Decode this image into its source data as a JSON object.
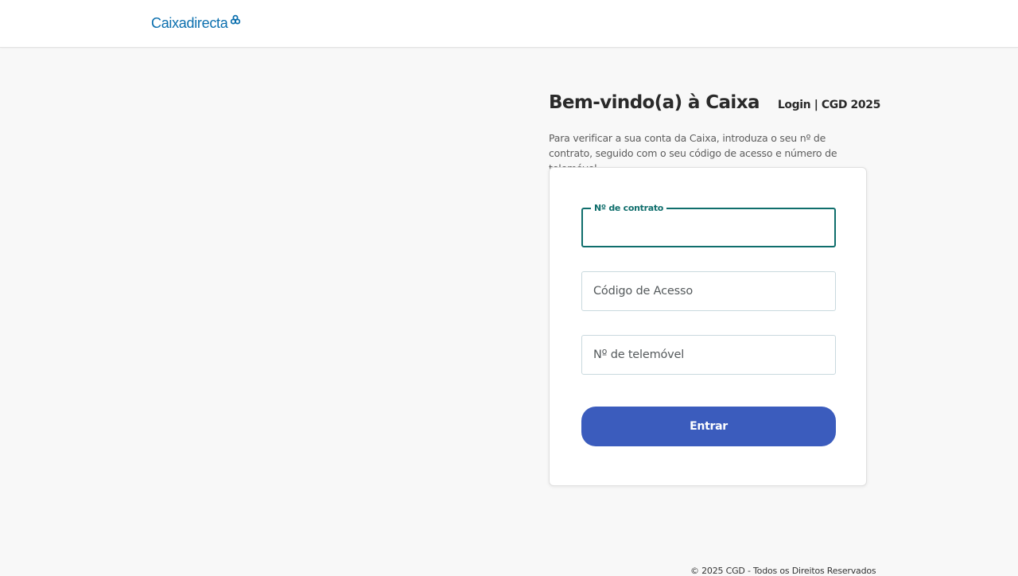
{
  "header": {
    "logo_text": "Caixadirecta"
  },
  "welcome": {
    "title": "Bem-vindo(a) à Caixa",
    "subtitle": "Login | CGD 2025",
    "intro": "Para verificar a sua conta da Caixa, introduza o seu nº de contrato, seguido com o seu código de acesso e número de telemóvel."
  },
  "form": {
    "contract_label": "Nº de contrato",
    "contract_value": "",
    "access_code_placeholder": "Código de Acesso",
    "phone_placeholder": "Nº de telemóvel",
    "submit_label": "Entrar"
  },
  "footer": {
    "copyright": "© 2025 CGD - Todos os Direitos Reservados"
  },
  "colors": {
    "brand_blue": "#0b6fae",
    "focus_teal": "#0f6e6c",
    "button_blue": "#3b5cbd",
    "page_background": "#f8f8f8"
  },
  "icons": {
    "logo_mark": "caixa-logo-icon"
  }
}
